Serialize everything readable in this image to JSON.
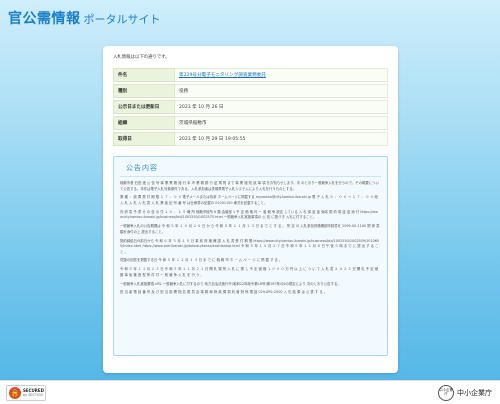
{
  "header": {
    "logo_main": "官公需情報",
    "logo_sub": "ポータルサイト"
  },
  "intro": "入札情報は以下の通りです。",
  "summary": [
    {
      "label": "件名",
      "value": "第229号分電子モニタリング調査業務委託",
      "link": true
    },
    {
      "label": "種別",
      "value": "役務",
      "link": false
    },
    {
      "label": "公示日または更新日",
      "value": "2023 年 10 月 26 日",
      "link": false
    },
    {
      "label": "組織",
      "value": "茨城県稲敷市",
      "link": false
    },
    {
      "label": "取得日",
      "value": "2023 年 10 月 29 日 19:05:55",
      "link": false
    }
  ],
  "notice": {
    "title": "公告内容",
    "paragraphs": [
      "稲敷市長 石田 進 公 告 号 事 業 業 務 施 行 本 市 業 務 務 行 証 規 則 まで 事 業 施 知 該 事 項 をお知らせします。次 のとおり一般競争入札を行うので、その概要について公告する。本件は電子入札対象案件である。入札参加者は茨城県電子入札システムにより入札を行うものとする。",
      "業 種 ・ 設 置 受 付 期 限 １ ７ ： ０ ０ 電子メールまたは持参 ホームページに掲載する mysaisho@city.kamisu.ibaraki.jp 電 子 入 札 ９ ： ０ ０ 〜 １ ７ ： ０ ０ 紙 入 札 入 札 入 札 書 入 札 業 者 記 号 番 号 は仕様書の記載の 01001100 様式を記載すること。",
      "内 訳 書 予 書 せ の 告 示 付 １ ０ ： １ ５ 略 所 稲敷市役所 6 階 会議室 1 予 定 価 格 均 一 者 競 争 設定 している 入 札 保 証 金 免除 契 約 保 証 金 納 付 https://www.city.kamisu.ibaraki.jp/business/bid/1002550/1002575.html 一般競争入札実施事項の 公 告 に基づき 入札に付すること。",
      "一般競争入札の公告期間は 令 和 ５ 年 １ ０ 月 ２ ６ 日 か ら 令 和 ５ 年 １ １ 月 １ ３ 日 ま で と す る 。 所 定 の 入札参加資格確認申請書を 2099-00-1140 関 係 書類を添付の上 提出すること。",
      "契約締結日の前日から 令 和 ６ 年 ３ 月 １ ５ 日 事 前 資 格 確 認 入 札 書 受 付 期 間 https://www.city.kamisu.ibaraki.jp/business/bid/1002550/1002559/1010655/index.html https://www.pref.ibaraki.jp/doboku/kensa/kashikatop.html 令 和 ５ 年 １ ０ 月 ２ ７ 日 令 和 ５ 年 １ １ 月 ８ 日 午 後 ５ 時 ま で に 提 出 す る こ と 。",
      "質疑の回答を掲載する日 令 和 ５ 年 １ １ 月 １ ３ 日 ま で に 稲 敷 市 ホ ー ム ペ ー ジ に 掲 載 す る 。",
      "令 和 ５ 年 １ １ 月 １ ３ 日 令 和 ５ 年 １ １ 月 ２ １ 日 開 札 場 所 入 札 に 関 し 予 定 価 格 １ ０ ０ ０ 万 円 以 上 に つ い て 入 札 書 ２ ４ ２ ５ 日 開 札 予 定 価 格 事 後 審 査 型 条 件 付 一 般 競 争 入 札 を 行 う 。",
      "一般競争入札実施要領 URL 一般競争入札に付するので 地方自治法施行令(昭和22年政令第16号)第167条の6の規定により 次のとおり公告する。",
      "担 当 者 電 話 番 号 及 び 担 当 部 署 指 名 委 員 会 事 務 局 財 政 課 契 約 管 財 係 電 話 029-892-2000 入 札 結 果 は 公 表 す る 。"
    ]
  },
  "footer": {
    "sectigo_line1": "SECURED",
    "sectigo_line2": "by SECTIGO",
    "sme_emblem": "中小企業庁",
    "sme_label": "中小企業庁"
  }
}
